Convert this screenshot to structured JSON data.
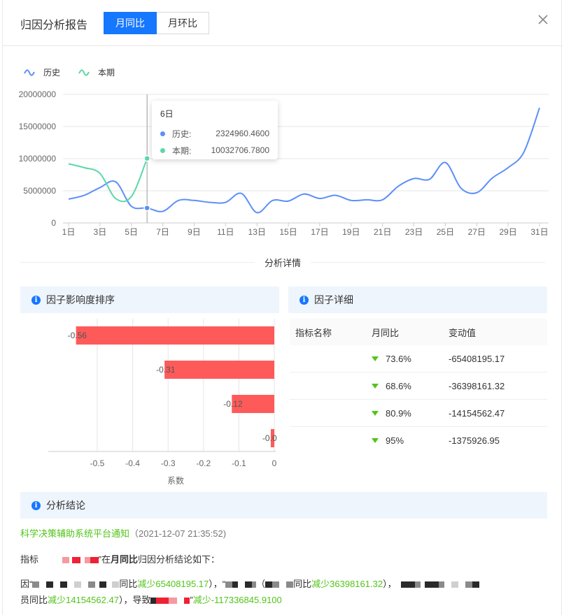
{
  "header": {
    "title": "归因分析报告",
    "tabs": [
      {
        "label": "月同比",
        "active": true
      },
      {
        "label": "月环比",
        "active": false
      }
    ]
  },
  "colors": {
    "accent": "#1677ff",
    "history_line": "#5b8ff9",
    "current_line": "#5ad8a6",
    "bar": "#ff5a5a",
    "decrease": "#52c41a"
  },
  "chart_data": [
    {
      "type": "line",
      "legend": [
        "历史",
        "本期"
      ],
      "legend_position": "top-left",
      "categories": [
        "1日",
        "2日",
        "3日",
        "4日",
        "5日",
        "6日",
        "7日",
        "8日",
        "9日",
        "10日",
        "11日",
        "12日",
        "13日",
        "14日",
        "15日",
        "16日",
        "17日",
        "18日",
        "19日",
        "20日",
        "21日",
        "22日",
        "23日",
        "24日",
        "25日",
        "26日",
        "27日",
        "28日",
        "29日",
        "30日",
        "31日"
      ],
      "x_tick_labels": [
        "1日",
        "3日",
        "5日",
        "7日",
        "9日",
        "11日",
        "13日",
        "15日",
        "17日",
        "19日",
        "21日",
        "23日",
        "25日",
        "27日",
        "29日",
        "31日"
      ],
      "y_tick_labels": [
        "0",
        "5000000",
        "10000000",
        "15000000",
        "20000000"
      ],
      "ylim": [
        0,
        20000000
      ],
      "grid": true,
      "series": [
        {
          "name": "历史",
          "values": [
            3700000,
            4300000,
            5500000,
            6400000,
            2600000,
            2324960.46,
            1800000,
            3500000,
            3500000,
            3200000,
            3200000,
            4600000,
            1600000,
            3500000,
            3400000,
            4500000,
            3800000,
            4300000,
            3500000,
            3600000,
            3600000,
            5700000,
            6900000,
            6800000,
            9400000,
            5400000,
            4700000,
            7000000,
            8600000,
            11000000,
            17900000
          ]
        },
        {
          "name": "本期",
          "values": [
            9200000,
            8600000,
            7700000,
            3800000,
            4100000,
            10032706.78
          ]
        }
      ],
      "tooltip": {
        "title": "6日",
        "rows": [
          {
            "name": "历史:",
            "value": "2324960.4600"
          },
          {
            "name": "本期:",
            "value": "10032706.7800"
          }
        ]
      }
    },
    {
      "type": "bar",
      "orientation": "horizontal",
      "xlabel": "系数",
      "xlim": [
        -0.55,
        0
      ],
      "x_tick_labels": [
        "-0.5",
        "-0.4",
        "-0.3",
        "-0.2",
        "-0.1",
        "0"
      ],
      "values": [
        -0.56,
        -0.31,
        -0.12,
        -0.01
      ],
      "data_labels": [
        "-0.56",
        "-0.31",
        "-0.12",
        "-0.0"
      ]
    }
  ],
  "section_divider": "分析详情",
  "left_panel": {
    "title": "因子影响度排序"
  },
  "right_panel": {
    "title": "因子详细",
    "columns": [
      "指标名称",
      "月同比",
      "变动值"
    ],
    "rows": [
      {
        "name": "",
        "ratio": "73.6%",
        "change": "-65408195.17"
      },
      {
        "name": "",
        "ratio": "68.6%",
        "change": "-36398161.32"
      },
      {
        "name": "",
        "ratio": "80.9%",
        "change": "-14154562.47"
      },
      {
        "name": "",
        "ratio": "95%",
        "change": "-1375926.95"
      }
    ]
  },
  "conclusion": {
    "title": "分析结论",
    "source": "科学决策辅助系统平台通知",
    "time": "（2021-12-07 21:35:52)",
    "line1_prefix": "指标",
    "line1_mid": "”在",
    "line1_bold": "月同比",
    "line1_suffix": "归因分析结论如下：",
    "line2_a": "因“",
    "line2_b": "同比",
    "line2_c": "减少65408195.17",
    "line2_d": "），“",
    "line2_e": "（",
    "line2_f": "同比",
    "line2_g": "减少36398161.32",
    "line2_h": "），",
    "line3_a": "员同比",
    "line3_b": "减少14154562.47",
    "line3_c": "），导致",
    "line3_d": "”",
    "line3_e": "减少-117336845.9100"
  }
}
